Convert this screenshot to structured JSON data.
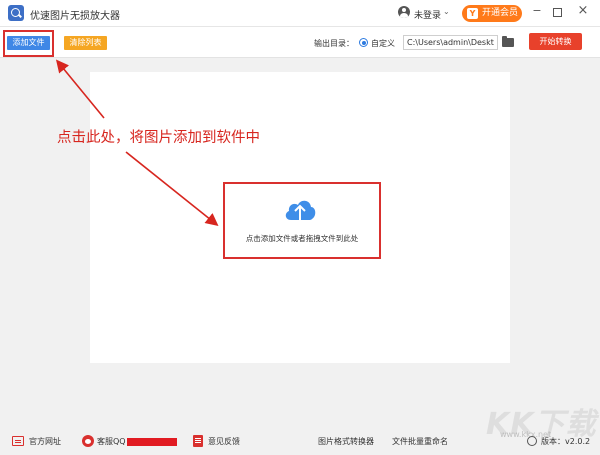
{
  "app": {
    "title": "优速图片无损放大器"
  },
  "header": {
    "login_label": "未登录",
    "vip_label": "开通会员",
    "vip_icon_text": "Y"
  },
  "toolbar": {
    "add_files_label": "添加文件",
    "clear_list_label": "清除列表",
    "output_dir_label": "输出目录：",
    "custom_label": "自定义",
    "output_path": "C:\\Users\\admin\\Deskto",
    "start_label": "开始转换"
  },
  "main": {
    "drop_hint": "点击添加文件或者拖拽文件到此处"
  },
  "annotation": {
    "text": "点击此处，将图片添加到软件中"
  },
  "footer": {
    "website_label": "官方网址",
    "support_label": "客服QQ",
    "feedback_label": "意见反馈",
    "format_converter_label": "图片格式转换器",
    "batch_rename_label": "文件批量重命名",
    "version_label": "版本：v2.0.2"
  },
  "watermark": {
    "brand": "KK下载",
    "url": "www.kkx.net"
  },
  "colors": {
    "accent_blue": "#3f87e6",
    "clear_orange": "#f5a623",
    "start_red": "#e8412b",
    "vip_orange": "#ff7a1a",
    "annotation_red": "#d7261f"
  },
  "icons": [
    "app-logo-icon",
    "user-icon",
    "chevron-down-icon",
    "minimize-icon",
    "maximize-icon",
    "close-icon",
    "folder-icon",
    "cloud-upload-icon",
    "website-icon",
    "qq-icon",
    "feedback-icon",
    "update-icon"
  ]
}
